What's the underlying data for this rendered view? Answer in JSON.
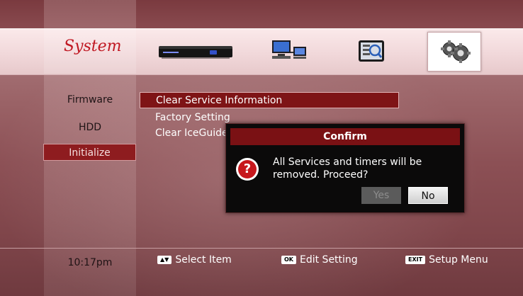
{
  "header": {
    "category_title": "System",
    "icons": [
      "set-top-box-icon",
      "network-icon",
      "guide-icon",
      "gears-icon"
    ]
  },
  "side_menu": {
    "items": [
      {
        "label": "Firmware"
      },
      {
        "label": "HDD"
      },
      {
        "label": "Initialize",
        "selected": true
      }
    ]
  },
  "options": {
    "items": [
      {
        "label": "Clear Service Information",
        "highlighted": true
      },
      {
        "label": "Factory Setting"
      },
      {
        "label": "Clear IceGuide"
      }
    ]
  },
  "dialog": {
    "title": "Confirm",
    "message_line1": "All Services and timers will be",
    "message_line2": "removed. Proceed?",
    "yes_label": "Yes",
    "no_label": "No",
    "focused_button": "No"
  },
  "footer": {
    "time": "10:17pm",
    "hints": [
      {
        "key": "▲▼",
        "label": "Select Item"
      },
      {
        "key": "OK",
        "label": "Edit Setting"
      },
      {
        "key": "EXIT",
        "label": "Setup Menu"
      }
    ]
  },
  "colors": {
    "accent_red": "#8e1c1f",
    "title_red": "#c01822",
    "dialog_bg": "#0b0a0a"
  }
}
